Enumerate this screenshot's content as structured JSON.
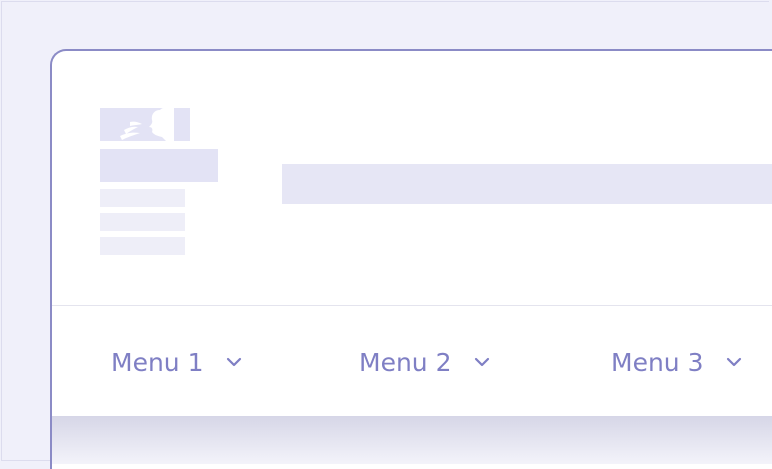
{
  "nav": {
    "menus": [
      {
        "label": "Menu 1",
        "icon": "chevron-down-icon"
      },
      {
        "label": "Menu 2",
        "icon": "chevron-down-icon"
      },
      {
        "label": "Menu 3",
        "icon": "chevron-down-icon"
      }
    ]
  },
  "colors": {
    "page_background": "#f0f0fa",
    "card_border": "#8b8bc6",
    "placeholder": "#e3e3f5",
    "menu_text": "#7f7fc4"
  }
}
